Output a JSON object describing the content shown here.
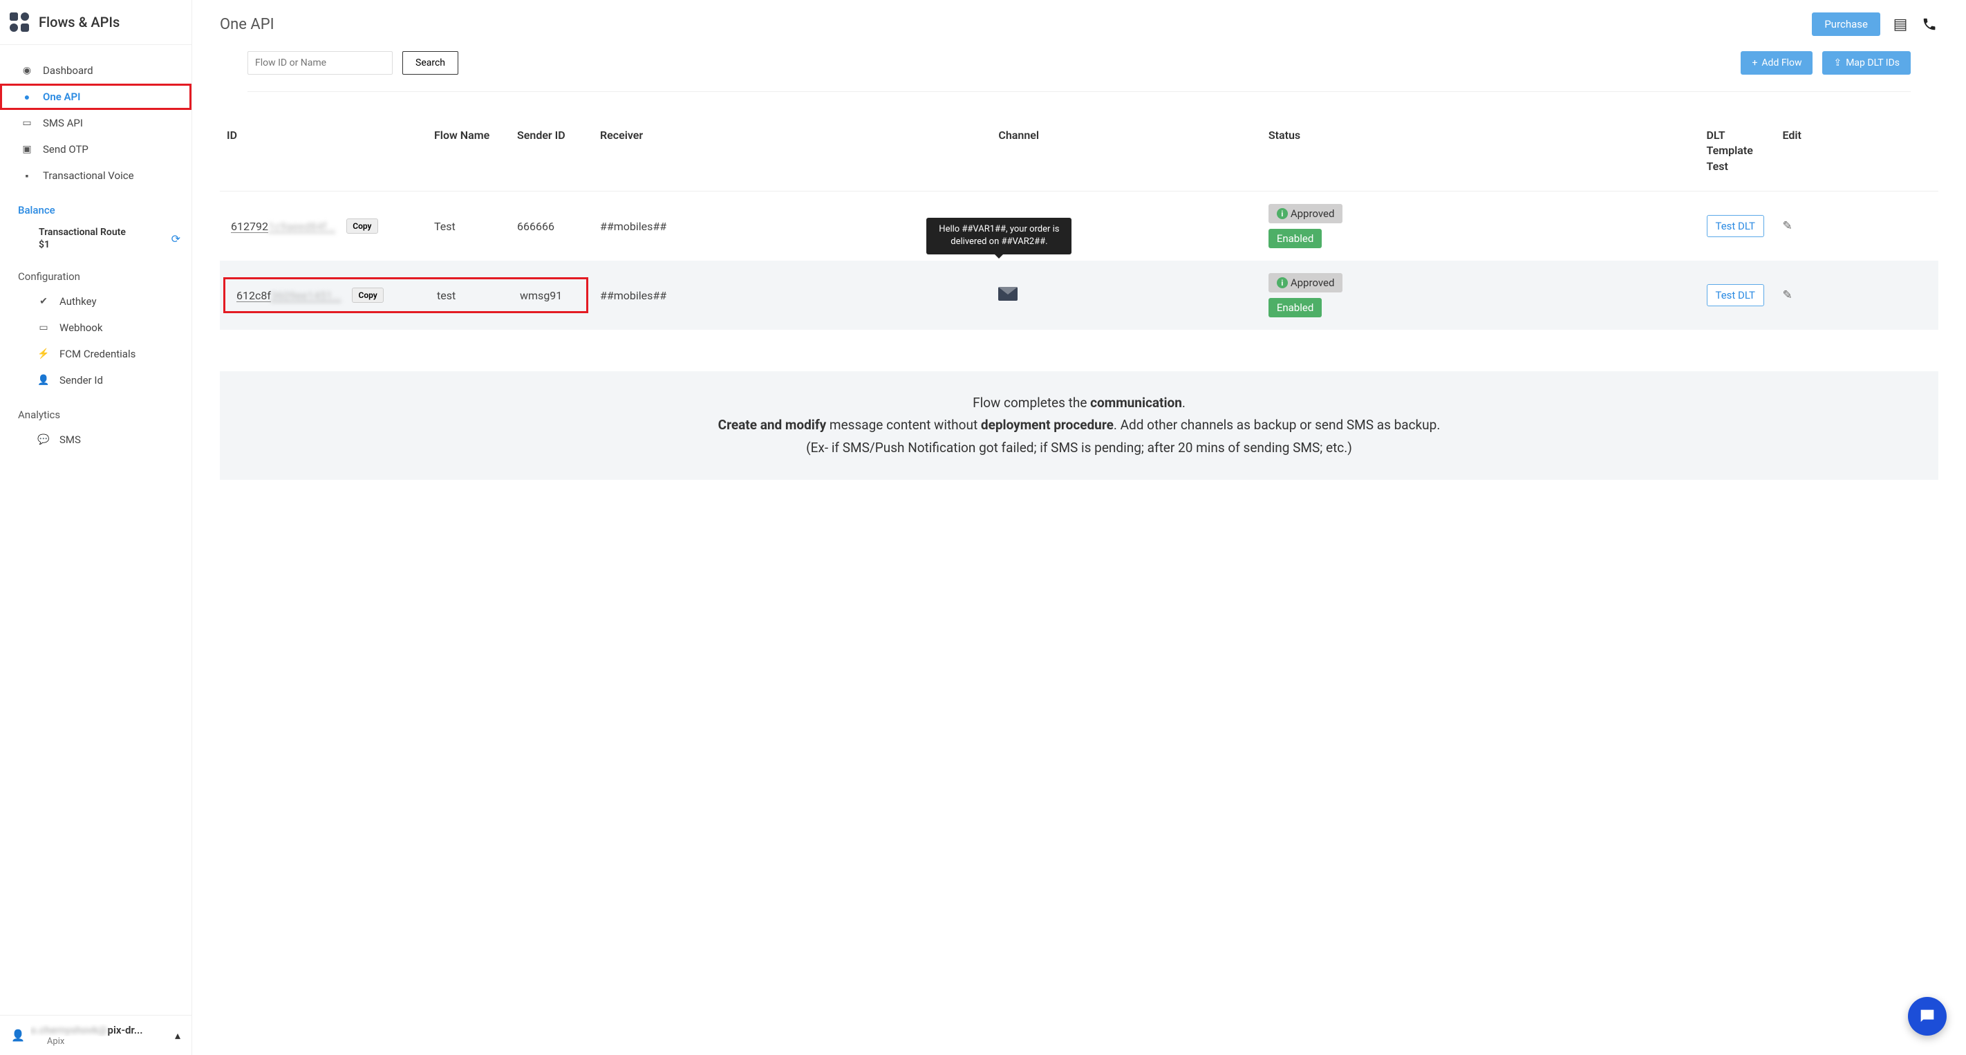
{
  "sidebar": {
    "title": "Flows & APIs",
    "nav": [
      {
        "id": "dashboard",
        "label": "Dashboard",
        "icon": "speed"
      },
      {
        "id": "one-api",
        "label": "One API",
        "icon": "circle-user",
        "active": true,
        "highlighted": true
      },
      {
        "id": "sms-api",
        "label": "SMS API",
        "icon": "card"
      },
      {
        "id": "send-otp",
        "label": "Send OTP",
        "icon": "briefcase"
      },
      {
        "id": "trans-voice",
        "label": "Transactional Voice",
        "icon": "chat-square"
      }
    ],
    "balance_header": "Balance",
    "balance_route": "Transactional Route",
    "balance_amount": "$1",
    "config_header": "Configuration",
    "config": [
      {
        "id": "authkey",
        "label": "Authkey",
        "icon": "shield"
      },
      {
        "id": "webhook",
        "label": "Webhook",
        "icon": "card"
      },
      {
        "id": "fcm",
        "label": "FCM Credentials",
        "icon": "bolt"
      },
      {
        "id": "sender-id",
        "label": "Sender Id",
        "icon": "person-search"
      }
    ],
    "analytics_header": "Analytics",
    "analytics": [
      {
        "id": "sms-analytics",
        "label": "SMS",
        "icon": "chat"
      }
    ],
    "user_email_blurred": "o.chernyshovk@",
    "user_email_visible": "pix-dr...",
    "user_org": "Apix"
  },
  "page": {
    "title": "One API",
    "purchase": "Purchase",
    "search_placeholder": "Flow ID or Name",
    "search_button": "Search",
    "add_flow": "Add Flow",
    "map_dlt": "Map DLT IDs"
  },
  "table": {
    "headers": [
      "ID",
      "Flow Name",
      "Sender ID",
      "Receiver",
      "Channel",
      "Status",
      "DLT Template Test",
      "Edit"
    ],
    "rows": [
      {
        "id_visible": "612792",
        "id_blurred": "1c9aeed84f...",
        "copy": "Copy",
        "flow_name": "Test",
        "sender_id": "666666",
        "receiver": "##mobiles##",
        "status_approved": "Approved",
        "status_enabled": "Enabled",
        "test_dlt": "Test DLT"
      },
      {
        "id_visible": "612c8f",
        "id_blurred": "3609ee1451...",
        "copy": "Copy",
        "flow_name": "test",
        "sender_id": "wmsg91",
        "receiver": "##mobiles##",
        "tooltip": "Hello ##VAR1##, your order is delivered on ##VAR2##.",
        "status_approved": "Approved",
        "status_enabled": "Enabled",
        "test_dlt": "Test DLT",
        "highlighted": true
      }
    ]
  },
  "infobox": {
    "line1_a": "Flow completes the ",
    "line1_b": "communication",
    "line1_c": ".",
    "line2_a": "Create and modify",
    "line2_b": " message content without ",
    "line2_c": "deployment procedure",
    "line2_d": ". Add other channels as backup or send SMS as backup.",
    "line3": "(Ex- if SMS/Push Notification got failed; if SMS is pending; after 20 mins of sending SMS; etc.)"
  }
}
